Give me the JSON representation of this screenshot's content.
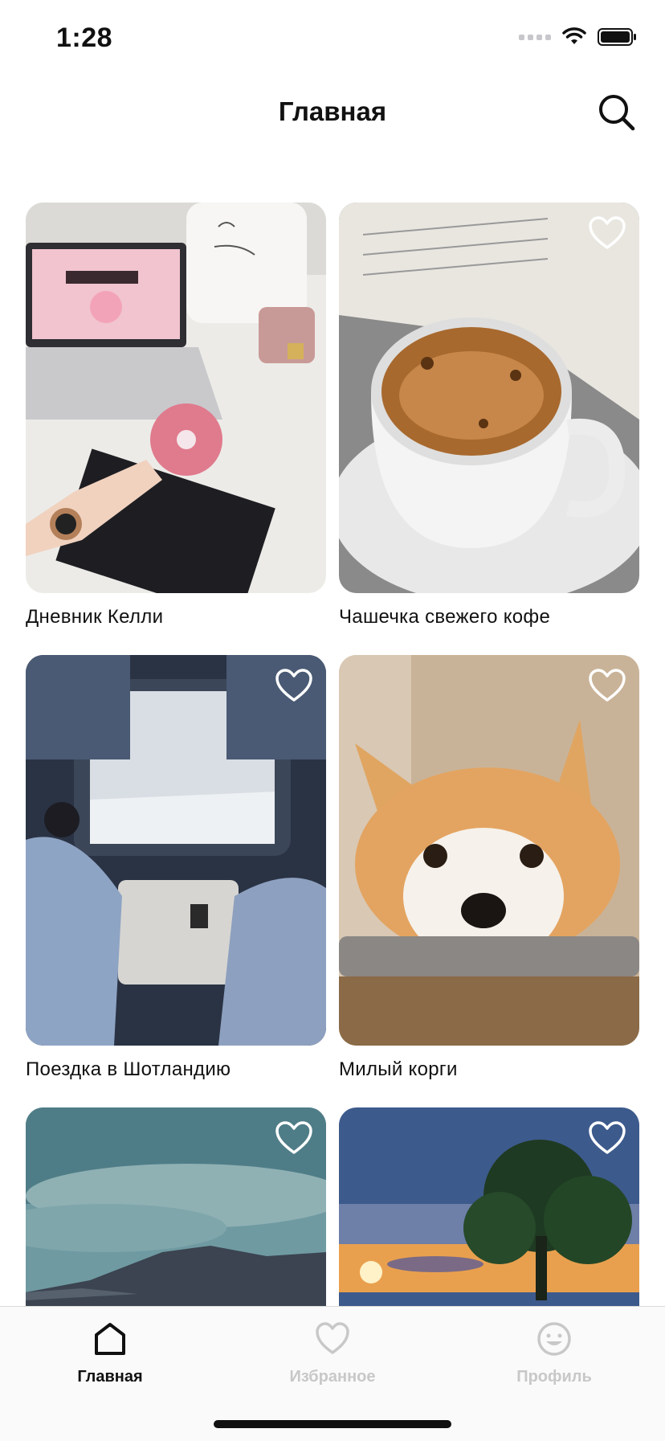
{
  "status_bar": {
    "time": "1:28"
  },
  "nav": {
    "title": "Главная"
  },
  "icons": {
    "search": "search-icon",
    "favorite": "heart-outline-icon",
    "home": "home-icon",
    "favorites_tab": "heart-icon",
    "profile": "smiley-icon"
  },
  "feed": {
    "items": [
      {
        "title": "Дневник Келли",
        "favorite_visible": false
      },
      {
        "title": "Чашечка свежего кофе",
        "favorite_visible": true
      },
      {
        "title": "Поездка в Шотландию",
        "favorite_visible": true
      },
      {
        "title": "Милый корги",
        "favorite_visible": true
      },
      {
        "title": "",
        "favorite_visible": true
      },
      {
        "title": "",
        "favorite_visible": true
      }
    ]
  },
  "tab_bar": {
    "tabs": [
      {
        "label": "Главная",
        "active": true
      },
      {
        "label": "Избранное",
        "active": false
      },
      {
        "label": "Профиль",
        "active": false
      }
    ]
  },
  "colors": {
    "active": "#111111",
    "inactive": "#c8c8c8",
    "background": "#ffffff"
  }
}
